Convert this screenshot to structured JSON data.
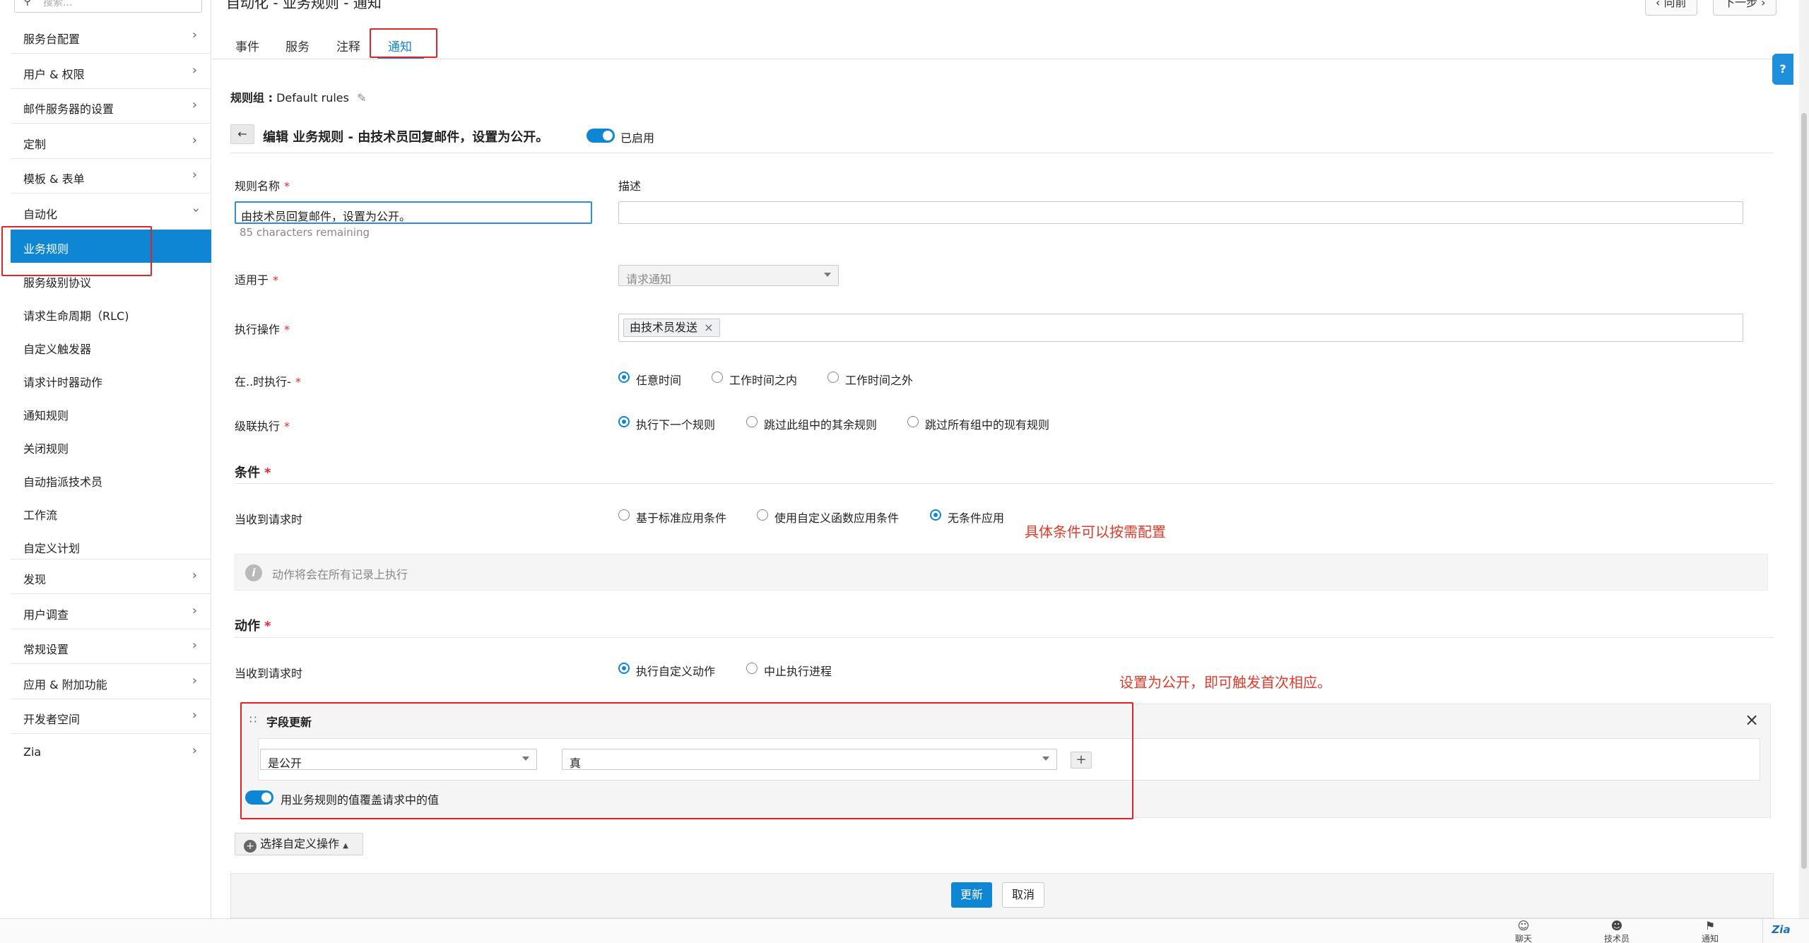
{
  "header": {
    "title": "自动化 - 业务规则 - 通知",
    "prev_label": "向前",
    "next_label": "下一步"
  },
  "sidebar": {
    "search_placeholder": "搜索...",
    "items": [
      {
        "label": "服务台配置"
      },
      {
        "label": "用户 & 权限"
      },
      {
        "label": "邮件服务器的设置"
      },
      {
        "label": "定制"
      },
      {
        "label": "模板 & 表单"
      },
      {
        "label": "自动化"
      }
    ],
    "sub_items": [
      {
        "label": "业务规则"
      },
      {
        "label": "服务级别协议"
      },
      {
        "label": "请求生命周期（RLC)"
      },
      {
        "label": "自定义触发器"
      },
      {
        "label": "请求计时器动作"
      },
      {
        "label": "通知规则"
      },
      {
        "label": "关闭规则"
      },
      {
        "label": "自动指派技术员"
      },
      {
        "label": "工作流"
      },
      {
        "label": "自定义计划"
      }
    ],
    "items_bottom": [
      {
        "label": "发现"
      },
      {
        "label": "用户调查"
      },
      {
        "label": "常规设置"
      },
      {
        "label": "应用 & 附加功能"
      },
      {
        "label": "开发者空间"
      },
      {
        "label": "Zia"
      }
    ]
  },
  "tabs": [
    {
      "label": "事件"
    },
    {
      "label": "服务"
    },
    {
      "label": "注释"
    },
    {
      "label": "通知"
    }
  ],
  "rule_group": {
    "label": "规则组 :",
    "value": "Default rules"
  },
  "edit": {
    "title": "编辑 业务规则 - 由技术员回复邮件，设置为公开。",
    "enabled_label": "已启用"
  },
  "form": {
    "rule_name_label": "规则名称",
    "rule_name_value": "由技术员回复邮件，设置为公开。",
    "chars_remaining": "85 characters remaining",
    "description_label": "描述",
    "description_value": "",
    "applies_to_label": "适用于",
    "applies_to_value": "请求通知",
    "execute_on_label": "执行操作",
    "execute_on_tag": "由技术员发送",
    "execute_time_label": "在..时执行-",
    "execute_time_options": [
      "任意时间",
      "工作时间之内",
      "工作时间之外"
    ],
    "cascade_label": "级联执行",
    "cascade_options": [
      "执行下一个规则",
      "跳过此组中的其余规则",
      "跳过所有组中的现有规则"
    ]
  },
  "conditions": {
    "title": "条件",
    "when_label": "当收到请求时",
    "options": [
      "基于标准应用条件",
      "使用自定义函数应用条件",
      "无条件应用"
    ],
    "annotation": "具体条件可以按需配置",
    "info_text": "动作将会在所有记录上执行"
  },
  "actions": {
    "title": "动作",
    "when_label": "当收到请求时",
    "options": [
      "执行自定义动作",
      "中止执行进程"
    ],
    "annotation": "设置为公开，即可触发首次相应。",
    "field_update_title": "字段更新",
    "field_value": "是公开",
    "value_value": "真",
    "add_symbol": "+",
    "override_label": "用业务规则的值覆盖请求中的值",
    "select_custom_label": "选择自定义操作"
  },
  "footer": {
    "update_label": "更新",
    "cancel_label": "取消"
  },
  "bottombar": {
    "items": [
      "聊天",
      "技术员",
      "通知"
    ],
    "zia_label": "Zia"
  },
  "help_symbol": "?",
  "colors": {
    "accent": "#0f86d3",
    "annotation_red": "#e23b2b"
  }
}
